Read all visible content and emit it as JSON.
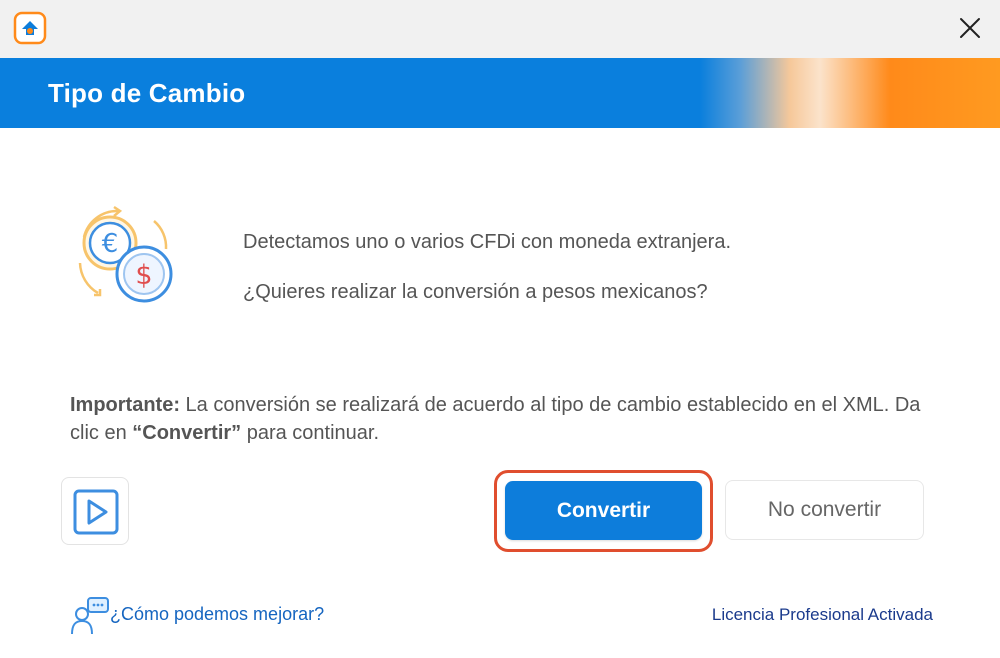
{
  "window": {
    "title": "Tipo de Cambio"
  },
  "icons": {
    "app": "app-logo-icon",
    "close": "close-icon",
    "illustration": "currency-exchange-icon",
    "video": "play-video-icon",
    "feedback": "feedback-chat-icon"
  },
  "colors": {
    "primary": "#0d7ddb",
    "accent": "#ff8a1a",
    "highlight": "#e04e2e"
  },
  "message": {
    "line1": "Detectamos uno o varios CFDi con moneda extranjera.",
    "line2": "¿Quieres realizar la conversión a pesos mexicanos?"
  },
  "important": {
    "label": "Importante:",
    "text1": " La conversión se realizará de acuerdo al tipo de cambio establecido en el XML. Da clic en ",
    "emphasis": "“Convertir”",
    "text2": " para continuar."
  },
  "buttons": {
    "convert": "Convertir",
    "no_convert": "No convertir"
  },
  "footer": {
    "feedback_link": "¿Cómo podemos mejorar?",
    "license": "Licencia Profesional Activada"
  }
}
